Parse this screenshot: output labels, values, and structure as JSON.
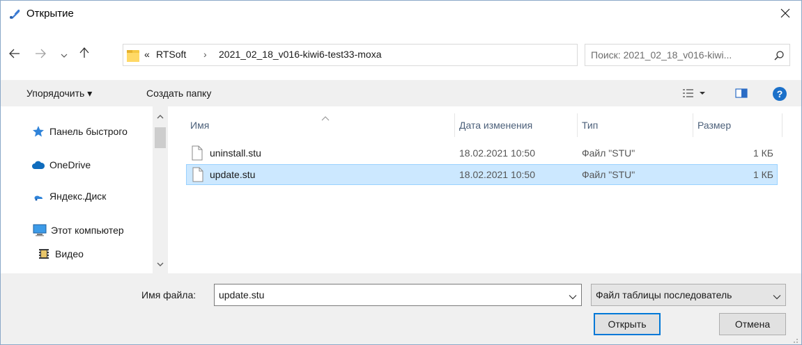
{
  "window": {
    "title": "Открытие",
    "app_icon": "app-feather-icon",
    "close_icon": "close-icon"
  },
  "nav": {
    "back_icon": "arrow-left-icon",
    "forward_icon": "arrow-right-icon",
    "recent_icon": "chevron-down-icon",
    "up_icon": "arrow-up-icon"
  },
  "address": {
    "overflow": "«",
    "crumbs": [
      "RTSoft",
      "2021_02_18_v016-kiwi6-test33-moxa"
    ],
    "separator": "›",
    "folder_icon": "folder-icon",
    "dropdown_icon": "chevron-down-icon",
    "refresh_icon": "refresh-icon"
  },
  "search": {
    "placeholder": "Поиск: 2021_02_18_v016-kiwi...",
    "icon": "search-icon"
  },
  "toolbar": {
    "organize_label": "Упорядочить ▾",
    "new_folder_label": "Создать папку",
    "view_icon": "view-details-icon",
    "preview_icon": "preview-pane-icon",
    "help_icon": "help-icon",
    "help_label": "?"
  },
  "sidebar": {
    "items": [
      {
        "label": "Панель быстрого",
        "icon": "quick-access-star-icon"
      },
      {
        "label": "OneDrive",
        "icon": "cloud-icon"
      },
      {
        "label": "Яндекс.Диск",
        "icon": "yandex-disk-icon"
      },
      {
        "label": "Этот компьютер",
        "icon": "computer-icon"
      },
      {
        "label": "Видео",
        "icon": "video-folder-icon"
      }
    ]
  },
  "columns": [
    "Имя",
    "Дата изменения",
    "Тип",
    "Размер"
  ],
  "files": [
    {
      "name": "uninstall.stu",
      "date": "18.02.2021 10:50",
      "type": "Файл \"STU\"",
      "size": "1 КБ",
      "selected": false
    },
    {
      "name": "update.stu",
      "date": "18.02.2021 10:50",
      "type": "Файл \"STU\"",
      "size": "1 КБ",
      "selected": true
    }
  ],
  "footer": {
    "filename_label": "Имя файла:",
    "filename_value": "update.stu",
    "filetype_value": "Файл таблицы последователь",
    "open_label": "Открыть",
    "cancel_label": "Отмена"
  },
  "colors": {
    "selection_bg": "#cce8ff",
    "selection_border": "#99d1ff",
    "accent": "#0078d7",
    "panel_bg": "#f0f0f0"
  }
}
